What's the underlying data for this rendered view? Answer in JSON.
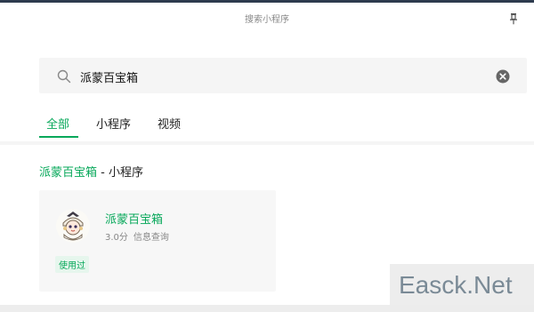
{
  "window": {
    "title": "搜索小程序",
    "pin_icon": "pin-icon"
  },
  "search": {
    "value": "派蒙百宝箱",
    "placeholder": "",
    "search_icon": "search-icon",
    "clear_icon": "clear-icon"
  },
  "tabs": [
    {
      "label": "全部",
      "active": true
    },
    {
      "label": "小程序",
      "active": false
    },
    {
      "label": "视频",
      "active": false
    }
  ],
  "section": {
    "title_highlight": "派蒙百宝箱",
    "title_suffix": " - 小程序"
  },
  "result": {
    "name": "派蒙百宝箱",
    "rating": "3.0分",
    "category": "信息查询",
    "badge": "使用过",
    "avatar_icon": "paimon-avatar-icon"
  },
  "watermark": {
    "text": "Easck.Net"
  },
  "colors": {
    "accent": "#07a85a",
    "top_bar": "#2e3b4e"
  }
}
